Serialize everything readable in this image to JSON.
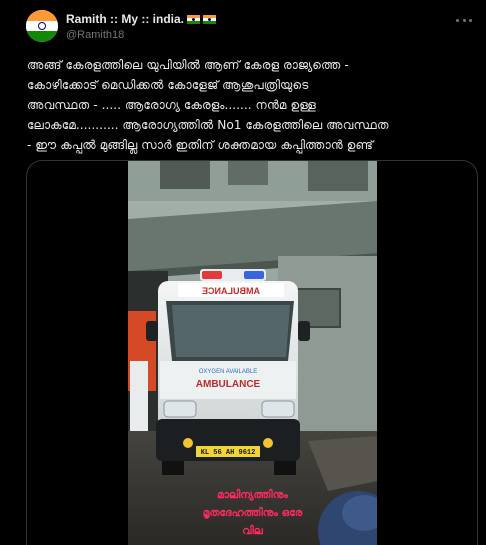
{
  "header": {
    "display_name": "Ramith :: My :: india.",
    "handle": "@Ramith18",
    "avatar_icon": "india-flag-avatar-icon",
    "name_flags": [
      "india-flag-icon",
      "india-flag-icon"
    ],
    "more_icon": "more-options-icon"
  },
  "tweet": {
    "text_lines": [
      "അങ്ങ് കേരളത്തിലെ യുപിയിൽ ആണ് കേരള രാജ്യത്തെ -",
      "കോഴിക്കോട് മെഡിക്കൽ കോളേജ് ആശുപത്രിയുടെ",
      "അവസ്ഥത - ..... ആരോഗ്യ കേരളം....... നൻമ ഉള്ള",
      "ലോകമേ........... ആരോഗ്യത്തിൽ No1 കേരളത്തിലെ അവസ്ഥത",
      "- ഈ കപ്പൽ മുങ്ങില്ല സാർ ഇതിന് ശക്തമായ കപ്പിത്താൻ ഉണ്ട്"
    ]
  },
  "media": {
    "vehicle_text": {
      "top_sign": "AMBULANCE",
      "side_text": "AMBULANCE",
      "oxygen_text": "OXYGEN AVAILABLE",
      "plate": "KL 56 AH 9612"
    },
    "caption_lines": [
      "മാലിന്യത്തിനും",
      "മൃതദേഹത്തിനും ഒരേ",
      "വില"
    ]
  },
  "colors": {
    "background": "#000000",
    "text": "#e7e9ea",
    "muted": "#71767b",
    "border": "#2f3336",
    "caption": "#ff2a5f"
  }
}
